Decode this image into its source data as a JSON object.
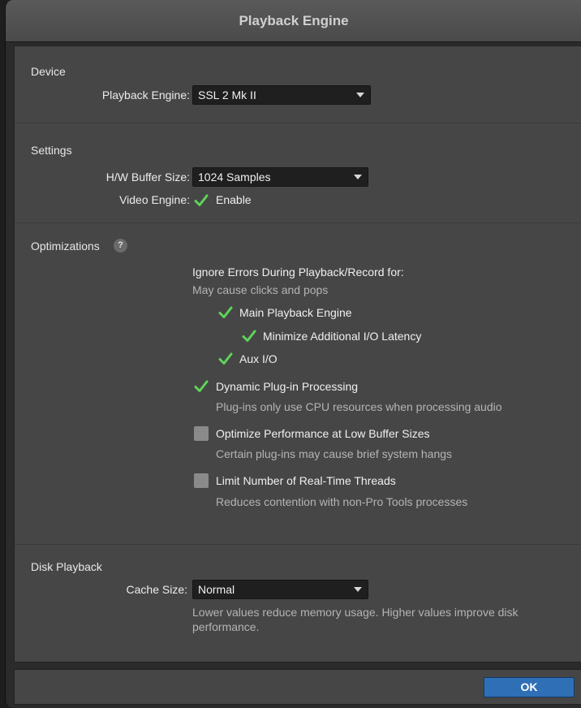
{
  "window": {
    "title": "Playback Engine"
  },
  "device": {
    "section_label": "Device",
    "playback_engine_label": "Playback Engine:",
    "playback_engine_value": "SSL 2 Mk II"
  },
  "settings": {
    "section_label": "Settings",
    "buffer_size_label": "H/W Buffer Size:",
    "buffer_size_value": "1024 Samples",
    "video_engine_label": "Video Engine:",
    "video_engine_checkbox_label": "Enable",
    "video_engine_enabled": true
  },
  "optimizations": {
    "section_label": "Optimizations",
    "help_glyph": "?",
    "ignore_errors_heading": "Ignore Errors During Playback/Record for:",
    "ignore_errors_note": "May cause clicks and pops",
    "main_playback_engine": {
      "label": "Main Playback Engine",
      "checked": true
    },
    "minimize_io_latency": {
      "label": "Minimize Additional I/O Latency",
      "checked": true
    },
    "aux_io": {
      "label": "Aux I/O",
      "checked": true
    },
    "dynamic_plugin": {
      "label": "Dynamic Plug-in Processing",
      "description": "Plug-ins only use CPU resources when processing audio",
      "checked": true
    },
    "optimize_low_buffer": {
      "label": "Optimize Performance at Low Buffer Sizes",
      "description": "Certain plug-ins may cause brief system hangs",
      "checked": false
    },
    "limit_threads": {
      "label": "Limit Number of Real-Time Threads",
      "description": "Reduces contention with non-Pro Tools processes",
      "checked": false
    }
  },
  "disk_playback": {
    "section_label": "Disk Playback",
    "cache_size_label": "Cache Size:",
    "cache_size_value": "Normal",
    "cache_note_line1": "Lower values reduce memory usage. Higher values improve disk",
    "cache_note_line2": "performance."
  },
  "footer": {
    "ok_label": "OK"
  },
  "colors": {
    "accent_blue": "#2f6fb6",
    "check_green": "#5fd35a",
    "panel_gray": "#464646"
  }
}
